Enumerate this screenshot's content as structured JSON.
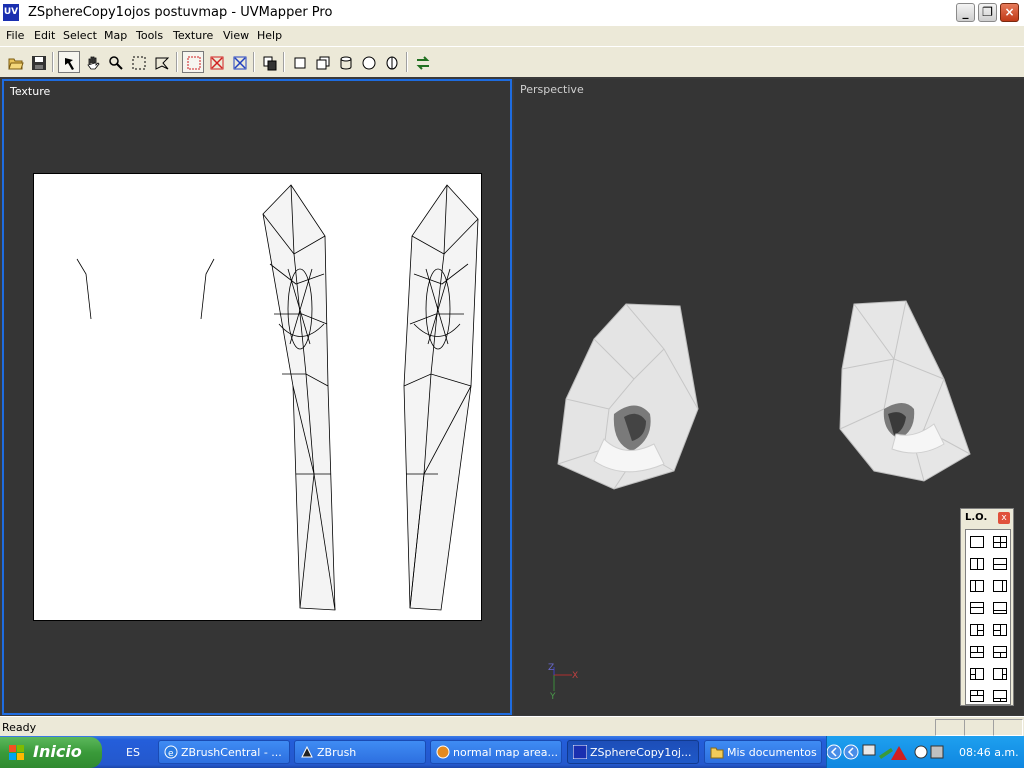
{
  "window": {
    "title": "ZSphereCopy1ojos postuvmap - UVMapper Pro",
    "app_icon_text": "UV"
  },
  "menu": [
    "File",
    "Edit",
    "Select",
    "Map",
    "Tools",
    "Texture",
    "View",
    "Help"
  ],
  "toolbar": {
    "buttons": [
      "open-icon",
      "save-icon",
      "undo-arrow-icon",
      "hand-pan-icon",
      "magnify-icon",
      "marquee-select-icon",
      "lasso-select-icon",
      "select-red-icon",
      "deselect-red-icon",
      "deselect-blue-icon",
      "copy-icon",
      "box-map-icon",
      "box-map-2-icon",
      "cylinder-map-icon",
      "sphere-map-icon",
      "head-map-icon",
      "swap-arrows-icon"
    ]
  },
  "panels": {
    "texture_label": "Texture",
    "perspective_label": "Perspective"
  },
  "axes": {
    "z": "Z",
    "x": "X",
    "y": "Y"
  },
  "lo_palette": {
    "title": "L.O.",
    "close": "x"
  },
  "status": {
    "text": "Ready"
  },
  "taskbar": {
    "start_label": "Inicio",
    "language": "ES",
    "tasks": [
      {
        "label": "ZBrushCentral - ..."
      },
      {
        "label": "ZBrush"
      },
      {
        "label": "normal map area..."
      },
      {
        "label": "ZSphereCopy1oj..."
      },
      {
        "label": "Mis documentos"
      }
    ],
    "clock": "08:46 a.m."
  },
  "colors": {
    "viewport_bg": "#353535",
    "active_border": "#1e6ce0",
    "taskbar": "#245edb",
    "start_green": "#3a9a3a"
  }
}
